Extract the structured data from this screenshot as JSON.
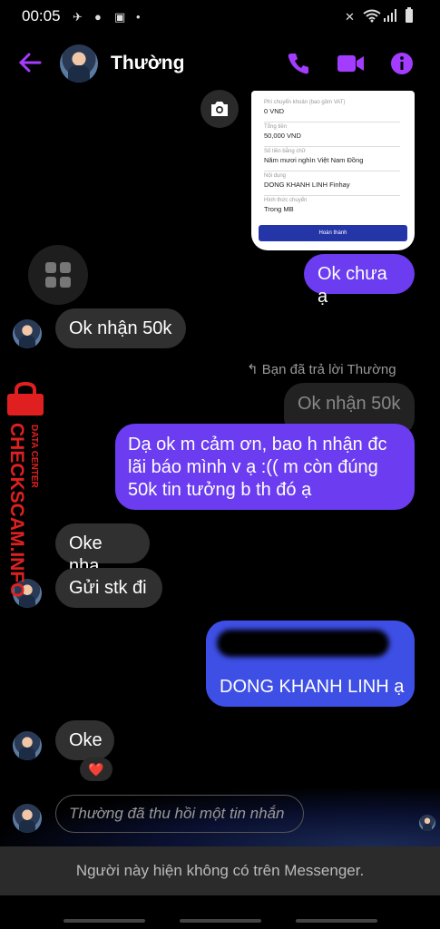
{
  "status_bar": {
    "time": "00:05"
  },
  "header": {
    "contact_name": "Thường"
  },
  "receipt": {
    "fee_label": "Phí chuyển khoản (bao gồm VAT)",
    "fee_value": "0 VND",
    "total_label": "Tổng tiền",
    "total_value": "50,000 VND",
    "words_label": "Số tiền bằng chữ",
    "words_value": "Năm mươi nghìn Việt Nam Đồng",
    "content_label": "Nội dung",
    "content_value": "DONG KHANH LINH Finhay",
    "method_label": "Hình thức chuyển",
    "method_value": "Trong MB",
    "button_label": "Hoàn thành"
  },
  "messages": {
    "m1": "Ok chưa ạ",
    "m2": "Ok nhận 50k",
    "reply_note": "Bạn đã trả lời Thường",
    "quoted": "Ok nhận 50k",
    "m3": "Dạ ok m cảm ơn, bao h nhận đc lãi báo mình v ạ :(( m còn đúng 50k tin tưởng b th đó ạ",
    "m4": "Oke nha",
    "m5": "Gửi stk đi",
    "m6_partial": "...ank",
    "m6_line2": "DONG KHANH LINH ạ",
    "m7": "Oke",
    "reaction": "❤️",
    "unsent": "Thường đã thu hồi một tin nhắn"
  },
  "watermark": {
    "main": "CHECKSCAM.INFO",
    "sub": "DATA CENTER"
  },
  "banner": "Người này hiện không có trên Messenger.",
  "icons": {
    "back": "back-arrow-icon",
    "phone": "phone-icon",
    "video": "video-icon",
    "info": "info-icon",
    "camera": "camera-icon",
    "grid": "grid-icon"
  },
  "colors": {
    "accent": "#a33cff",
    "bubble_out": "#6b3cf0",
    "bubble_out_alt": "#3e4fe6",
    "bubble_in": "#303030"
  }
}
